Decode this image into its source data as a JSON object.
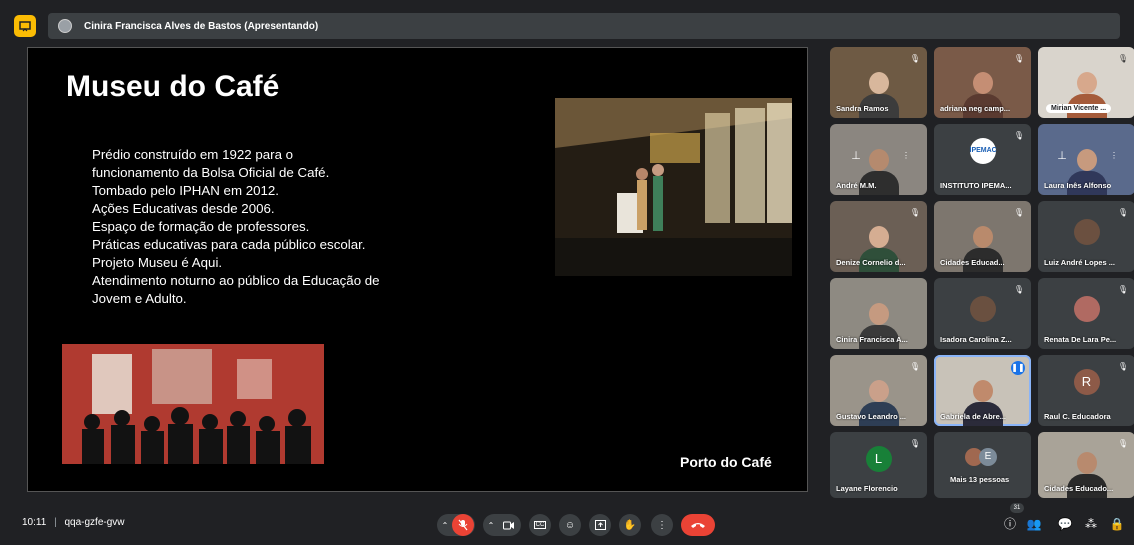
{
  "topbar": {
    "presenter": "Cinira Francisca Alves de Bastos (Apresentando)",
    "icon": "presentation-icon"
  },
  "slide": {
    "title": "Museu do Café",
    "bullets": [
      "Prédio construído em 1922 para o",
      "funcionamento da Bolsa Oficial de Café.",
      "Tombado pelo IPHAN em 2012.",
      "Ações Educativas desde 2006.",
      "Espaço de formação de professores.",
      "Práticas educativas para cada público escolar.",
      "Projeto Museu é Aqui.",
      "Atendimento noturno ao público da Educação de",
      "Jovem e Adulto."
    ],
    "caption": "Porto do Café"
  },
  "participants": [
    {
      "name": "Sandra Ramos"
    },
    {
      "name": "adriana neg camp..."
    },
    {
      "name": "Mirian Vicente ..."
    },
    {
      "name": "André M.M."
    },
    {
      "name": "INSTITUTO IPEMA...",
      "logo": "IPEMAC"
    },
    {
      "name": "Laura Inês Alfonso"
    },
    {
      "name": "Denize Cornelio d..."
    },
    {
      "name": "Cidades Educad..."
    },
    {
      "name": "Luiz André Lopes ..."
    },
    {
      "name": "Cinira Francisca A..."
    },
    {
      "name": "Isadora Carolina Z..."
    },
    {
      "name": "Renata De Lara Pe..."
    },
    {
      "name": "Gustavo Leandro ..."
    },
    {
      "name": "Gabriela de Abre..."
    },
    {
      "name": "Raul C. Educadora",
      "letter": "R"
    },
    {
      "name": "Layane Florencio",
      "letter": "L"
    },
    {
      "name": "Mais 13 pessoas",
      "letter": "E"
    },
    {
      "name": "Cidades Educado..."
    }
  ],
  "bottombar": {
    "time": "10:11",
    "meeting_code": "qqa-gzfe-gvw",
    "participant_count": "31",
    "cc_label": "CC"
  },
  "colors": {
    "accent_blue": "#1a73e8",
    "end_call_red": "#ea4335",
    "present_yellow": "#fbbc04"
  }
}
